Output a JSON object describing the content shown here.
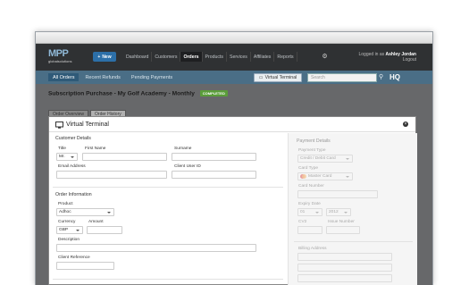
{
  "header": {
    "logo_text": "MPP",
    "logo_sub": "globalsolutions",
    "new_label": "New",
    "nav": [
      "Dashboard",
      "Customers",
      "Orders",
      "Products",
      "Services",
      "Affiliates",
      "Reports"
    ],
    "active_nav": "Orders",
    "user_prefix": "Logged in as",
    "user_name": "Ashley Jordan",
    "logout": "Logout"
  },
  "subnav": {
    "tabs": [
      "All Orders",
      "Recent Refunds",
      "Pending Payments"
    ],
    "virtual_terminal_label": "Virtual Terminal",
    "search_placeholder": "Search",
    "hq_label": "HQ"
  },
  "page": {
    "title": "Subscription Purchase - My Golf Academy - Monthly",
    "status_badge": "COMPLETED",
    "tabs": [
      "Order Overview",
      "Order History"
    ]
  },
  "modal": {
    "title": "Virtual Terminal",
    "customer": {
      "heading": "Customer Details",
      "title_label": "Title",
      "title_value": "Mr.",
      "first_name_label": "First Name",
      "surname_label": "Surname",
      "email_label": "Email Address",
      "client_user_id_label": "Client User ID"
    },
    "order": {
      "heading": "Order Information",
      "product_label": "Product",
      "product_value": "Adhoc",
      "currency_label": "Currency",
      "currency_value": "GBP",
      "amount_label": "Amount",
      "description_label": "Description",
      "client_reference_label": "Client Reference"
    },
    "payment": {
      "heading": "Payment Details",
      "payment_type_label": "Payment Type",
      "payment_type_value": "Credit / Debit Card",
      "card_type_label": "Card Type",
      "card_type_value": "Master Card",
      "card_number_label": "Card Number",
      "expiry_label": "Expiry Date",
      "expiry_month": "01",
      "expiry_year": "2012",
      "cv2_label": "CV2",
      "issue_number_label": "Issue Number",
      "billing_address_label": "Billing Address"
    }
  }
}
